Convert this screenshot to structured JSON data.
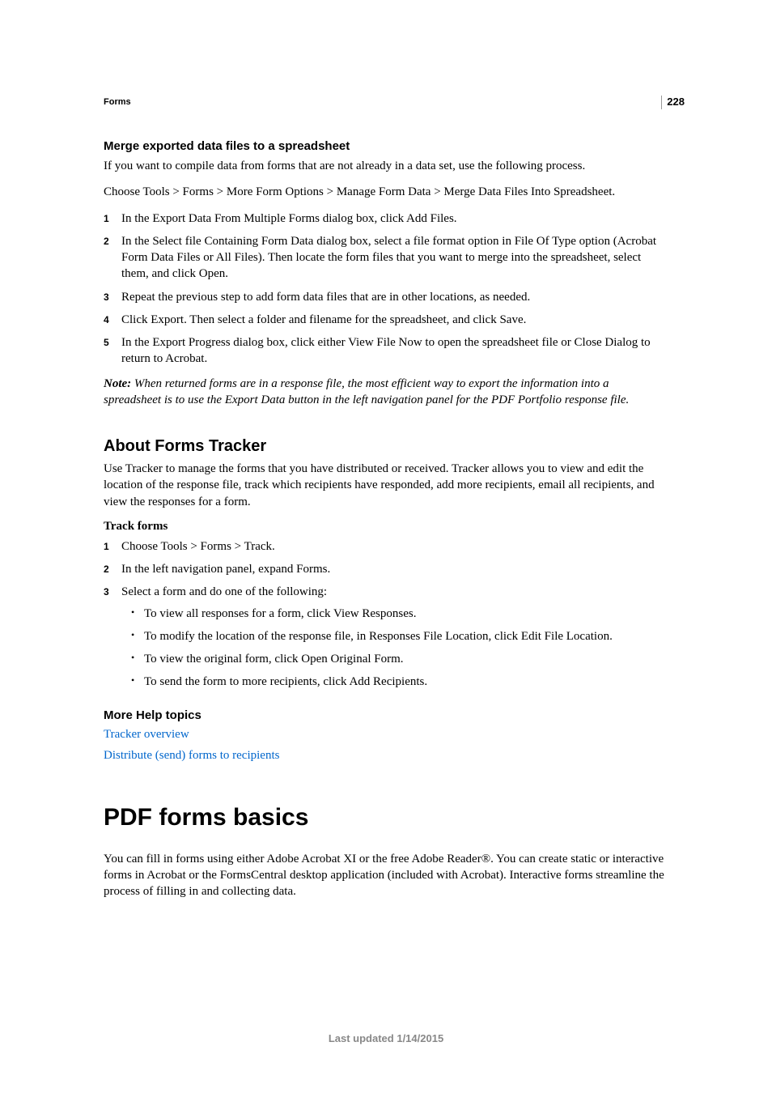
{
  "page_number": "228",
  "breadcrumb": "Forms",
  "section1": {
    "heading": "Merge exported data files to a spreadsheet",
    "p1": "If you want to compile data from forms that are not already in a data set, use the following process.",
    "p2": "Choose Tools > Forms > More Form Options > Manage Form Data > Merge Data Files Into Spreadsheet.",
    "steps": [
      "In the Export Data From Multiple Forms dialog box, click Add Files.",
      "In the Select file Containing Form Data dialog box, select a file format option in File Of Type option (Acrobat Form Data Files or All Files). Then locate the form files that you want to merge into the spreadsheet, select them, and click Open.",
      "Repeat the previous step to add form data files that are in other locations, as needed.",
      "Click Export. Then select a folder and filename for the spreadsheet, and click Save.",
      "In the Export Progress dialog box, click either View File Now to open the spreadsheet file or Close Dialog to return to Acrobat."
    ],
    "note_label": "Note:",
    "note_body": " When returned forms are in a response file, the most efficient way to export the information into a spreadsheet is to use the Export Data button in the left navigation panel for the PDF Portfolio response file."
  },
  "section2": {
    "heading": "About Forms Tracker",
    "p1": "Use Tracker to manage the forms that you have distributed or received. Tracker allows you to view and edit the location of the response file, track which recipients have responded, add more recipients, email all recipients, and view the responses for a form.",
    "subhead": "Track forms",
    "steps": [
      "Choose Tools > Forms > Track.",
      "In the left navigation panel, expand Forms.",
      "Select a form and do one of the following:"
    ],
    "bullets": [
      "To view all responses for a form, click View Responses.",
      "To modify the location of the response file, in Responses File Location, click Edit File Location.",
      "To view the original form, click Open Original Form.",
      "To send the form to more recipients, click Add Recipients."
    ]
  },
  "morehelp": {
    "heading": "More Help topics",
    "links": [
      "Tracker overview",
      "Distribute (send) forms to recipients"
    ]
  },
  "section3": {
    "heading": "PDF forms basics",
    "p1": "You can fill in forms using either Adobe Acrobat XI or the free Adobe Reader®. You can create static or interactive forms in Acrobat or the FormsCentral desktop application (included with Acrobat). Interactive forms streamline the process of filling in and collecting data."
  },
  "footer": "Last updated 1/14/2015"
}
